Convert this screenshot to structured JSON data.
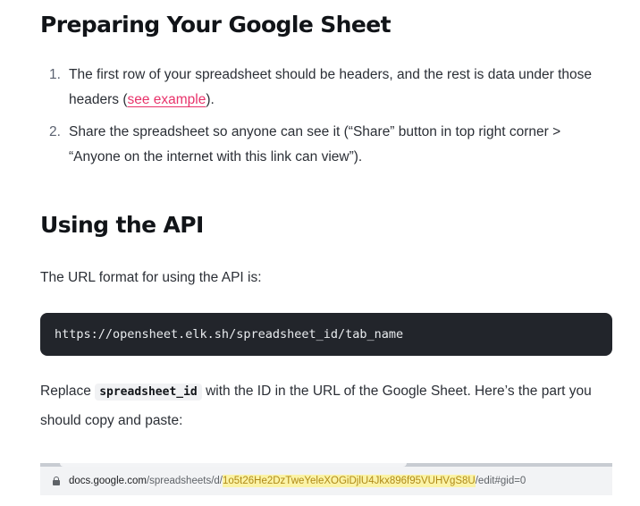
{
  "sections": {
    "prep": {
      "heading": "Preparing Your Google Sheet",
      "steps": [
        {
          "num": "1.",
          "text_before": "The first row of your spreadsheet should be headers, and the rest is data under those headers (",
          "link": "see example",
          "text_after": ")."
        },
        {
          "num": "2.",
          "text": "Share the spreadsheet so anyone can see it (“Share” button in top right corner > “Anyone on the internet with this link can view”)."
        }
      ]
    },
    "api": {
      "heading": "Using the API",
      "format_text": "The URL format for using the API is:",
      "code": "https://opensheet.elk.sh/spreadsheet_id/tab_name",
      "replace": {
        "before": "Replace ",
        "code": "spreadsheet_id",
        "after": " with the ID in the URL of the Google Sheet. Here’s the part you should copy and paste:"
      }
    }
  },
  "url_screenshot": {
    "domain": "docs.google.com",
    "path_prefix": "/spreadsheets/d/",
    "sheet_id": "1o5t26He2DzTweYeleXOGiDjlU4Jkx896f95VUHVgS8U",
    "path_suffix": "/edit#gid=0"
  },
  "colors": {
    "link": "#e8336b",
    "code_bg": "#22252b",
    "highlight": "#fbf3a6"
  }
}
